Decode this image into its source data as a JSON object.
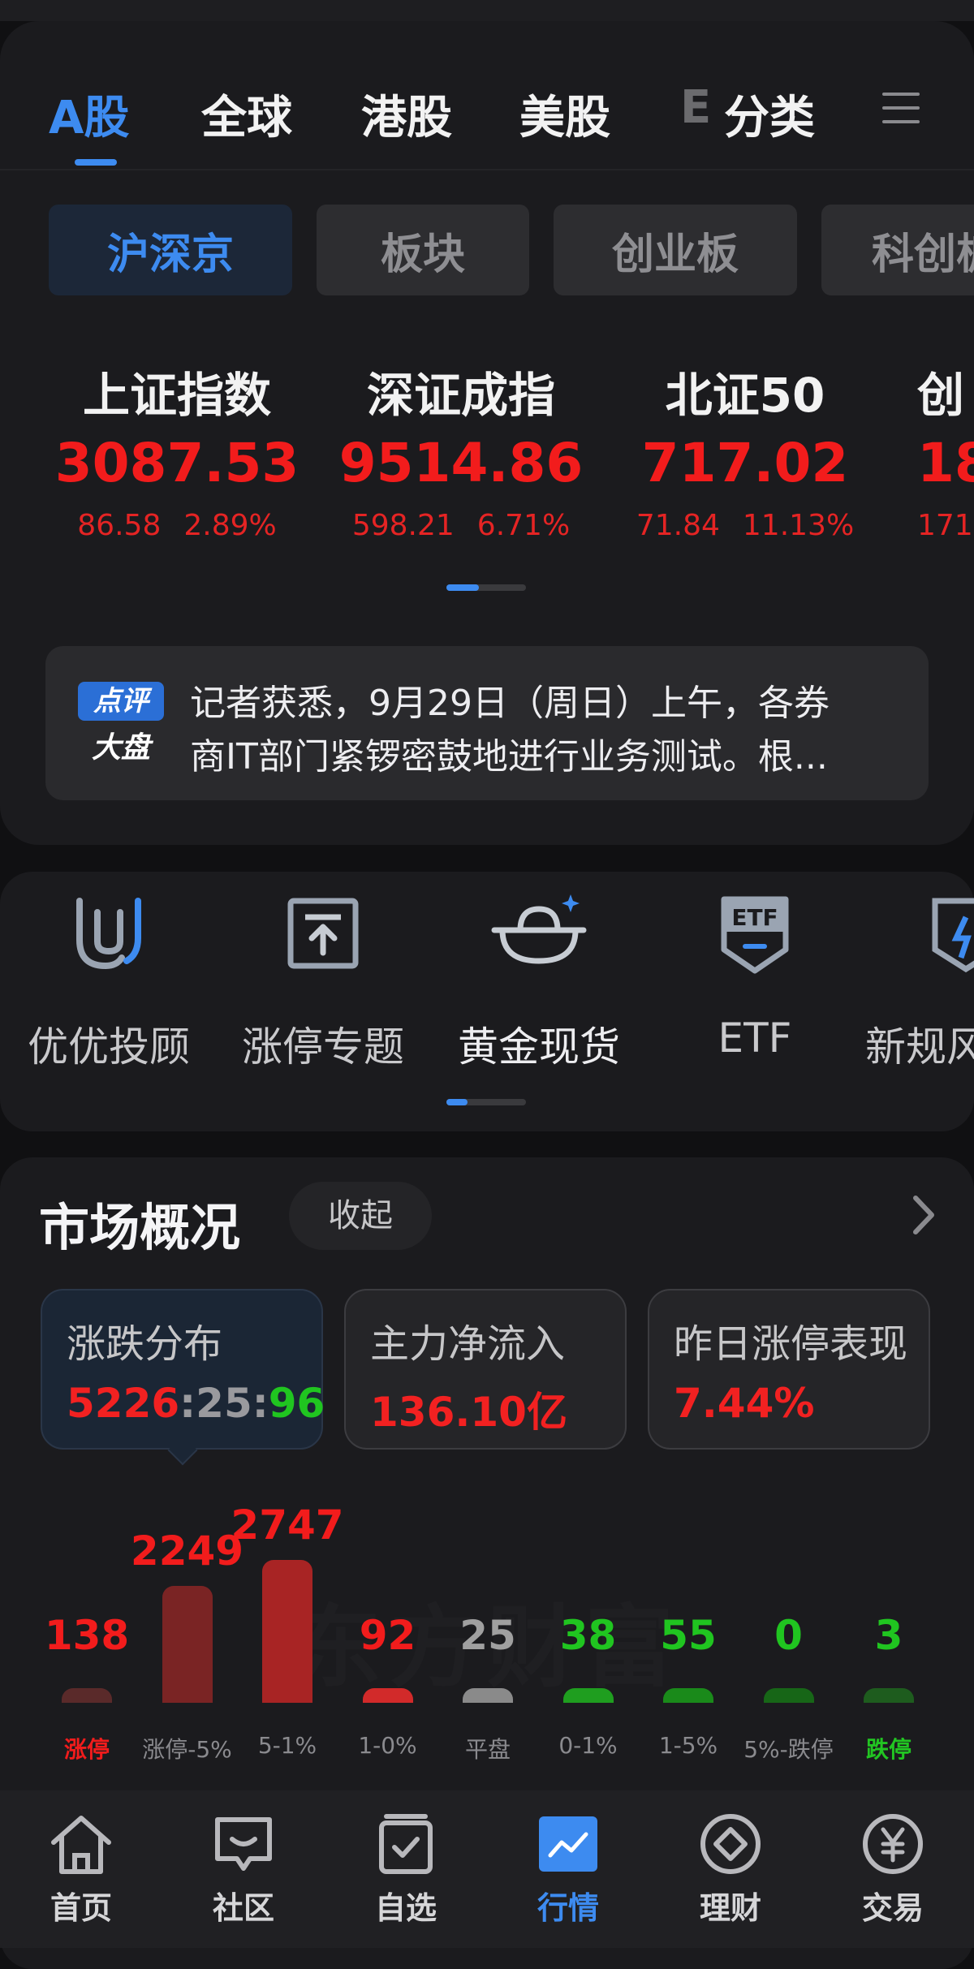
{
  "tabs": [
    {
      "label": "A股"
    },
    {
      "label": "全球"
    },
    {
      "label": "港股"
    },
    {
      "label": "美股"
    },
    {
      "label": "E"
    },
    {
      "label": "分类"
    }
  ],
  "sub_tabs": [
    "沪深京",
    "板块",
    "创业板",
    "科创板"
  ],
  "indices": [
    {
      "name": "上证指数",
      "value": "3087.53",
      "change": "86.58",
      "pct": "2.89%"
    },
    {
      "name": "深证成指",
      "value": "9514.86",
      "change": "598.21",
      "pct": "6.71%"
    },
    {
      "name": "北证50",
      "value": "717.02",
      "change": "71.84",
      "pct": "11.13%"
    },
    {
      "name": "创",
      "value": "18",
      "change": "171.",
      "pct": ""
    }
  ],
  "news": {
    "badge_top": "点评",
    "badge_bottom": "大盘",
    "line1": "记者获悉，9月29日（周日）上午，各券",
    "line2": "商IT部门紧锣密鼓地进行业务测试。根..."
  },
  "shortcuts": [
    {
      "label": "优优投顾",
      "icon": "uu-advisor-icon"
    },
    {
      "label": "涨停专题",
      "icon": "limit-up-topic-icon"
    },
    {
      "label": "黄金现货",
      "icon": "gold-ingot-icon"
    },
    {
      "label": "ETF",
      "icon": "etf-icon"
    },
    {
      "label": "新规风",
      "icon": "new-rules-icon"
    }
  ],
  "market": {
    "title": "市场概况",
    "collapse_label": "收起",
    "cards": [
      {
        "title": "涨跌分布",
        "up": "5226",
        "flat": "25",
        "down": "96",
        "sep": ":"
      },
      {
        "title": "主力净流入",
        "value": "136.10亿"
      },
      {
        "title": "昨日涨停表现",
        "value": "7.44%"
      }
    ],
    "watermark": "东方财富"
  },
  "chart_data": {
    "type": "bar",
    "categories": [
      "涨停",
      "涨停-5%",
      "5-1%",
      "1-0%",
      "平盘",
      "0-1%",
      "1-5%",
      "5%-跌停",
      "跌停"
    ],
    "values": [
      138,
      2249,
      2747,
      92,
      25,
      38,
      55,
      0,
      3
    ],
    "colors": [
      "#5a2a2a",
      "#7a2424",
      "#a82424",
      "#d22a2a",
      "#8a8a8a",
      "#1f9e1f",
      "#1a8a1a",
      "#176617",
      "#1e5c1e"
    ],
    "label_colors": [
      "#f21c1c",
      "#f21c1c",
      "#f21c1c",
      "#f21c1c",
      "#a0a0a0",
      "#20c520",
      "#20c520",
      "#20c520",
      "#20c520"
    ],
    "category_label_colors": [
      "#f21c1c",
      "#8a8a8e",
      "#8a8a8e",
      "#8a8a8e",
      "#8a8a8e",
      "#8a8a8e",
      "#8a8a8e",
      "#8a8a8e",
      "#22c522"
    ]
  },
  "bottom_nav": [
    {
      "label": "首页",
      "icon": "home-icon"
    },
    {
      "label": "社区",
      "icon": "community-icon"
    },
    {
      "label": "自选",
      "icon": "watchlist-icon"
    },
    {
      "label": "行情",
      "icon": "market-icon",
      "active": true
    },
    {
      "label": "理财",
      "icon": "wealth-icon"
    },
    {
      "label": "交易",
      "icon": "trade-icon"
    }
  ],
  "colors": {
    "accent": "#3d8bf0",
    "up": "#f21c1c",
    "down": "#20c520"
  }
}
